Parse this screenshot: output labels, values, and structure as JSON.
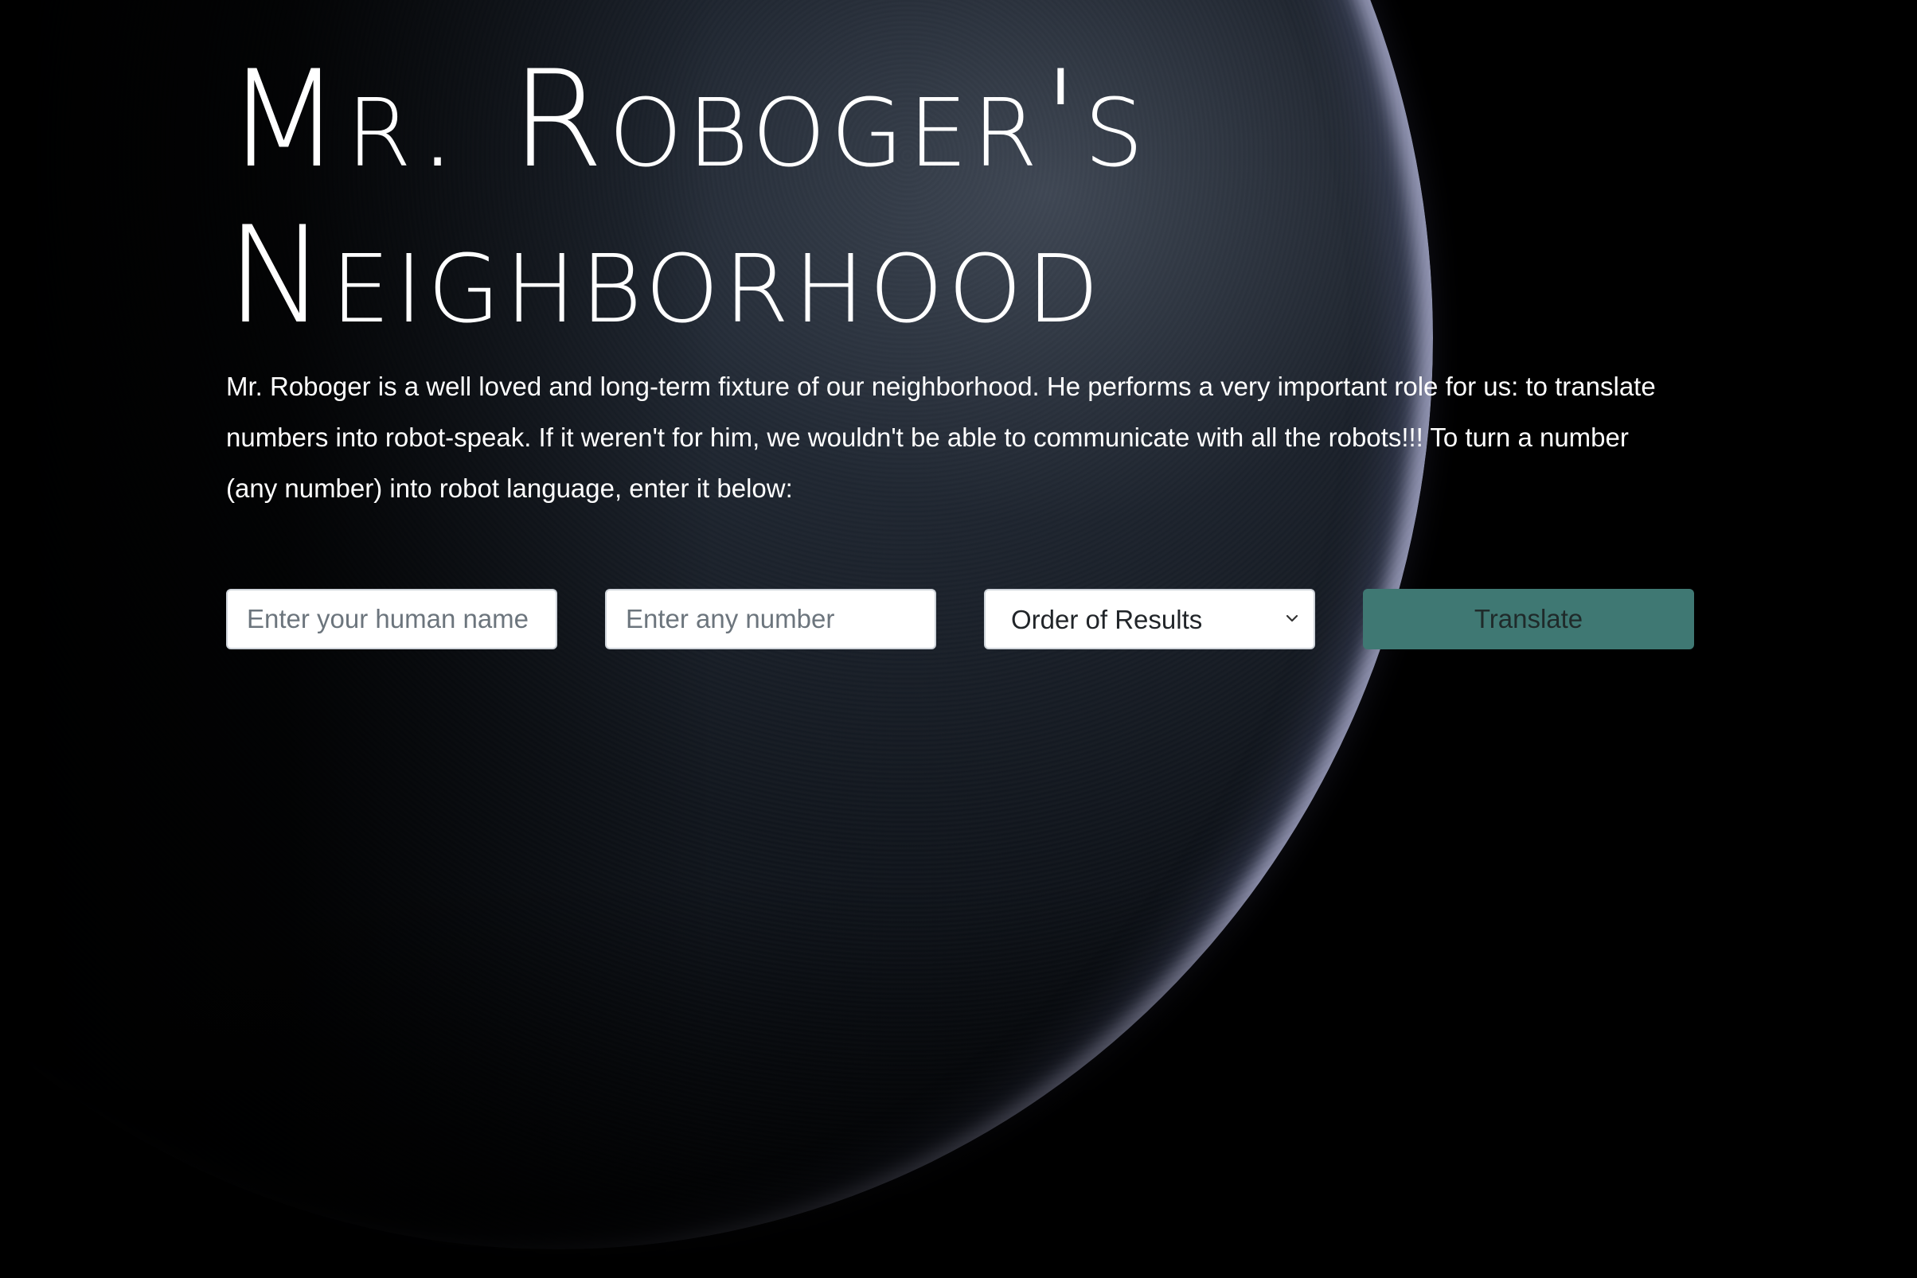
{
  "header": {
    "title_line1": "Mr. Roboger's",
    "title_line2": "Neighborhood"
  },
  "intro": {
    "text": "Mr. Roboger is a well loved and long-term fixture of our neighborhood. He performs a very important role for us: to translate numbers into robot-speak. If it weren't for him, we wouldn't be able to communicate with all the robots!!! To turn a number (any number) into robot language, enter it below:"
  },
  "form": {
    "name_input": {
      "placeholder": "Enter your human name",
      "value": ""
    },
    "number_input": {
      "placeholder": "Enter any number",
      "value": ""
    },
    "order_select": {
      "selected": "Order of Results"
    },
    "translate_button": {
      "label": "Translate"
    }
  },
  "colors": {
    "background": "#000000",
    "button": "#3f7873",
    "text": "#ffffff"
  },
  "icons": {
    "select_arrow": "chevron-down-icon"
  }
}
